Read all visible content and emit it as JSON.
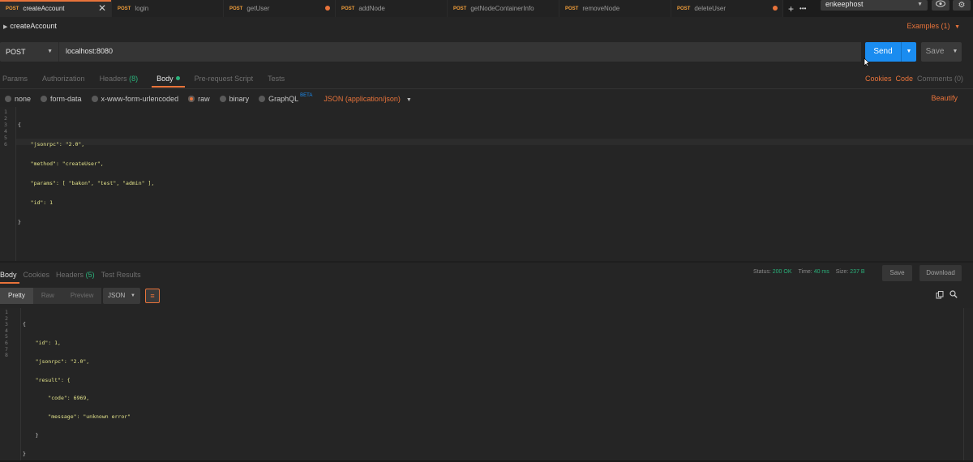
{
  "tabs": [
    {
      "method": "POST",
      "title": "createAccount",
      "active": true,
      "close": "✕"
    },
    {
      "method": "POST",
      "title": "login"
    },
    {
      "method": "POST",
      "title": "getUser",
      "modified": true
    },
    {
      "method": "POST",
      "title": "addNode"
    },
    {
      "method": "POST",
      "title": "getNodeContainerInfo"
    },
    {
      "method": "POST",
      "title": "removeNode"
    },
    {
      "method": "POST",
      "title": "deleteUser",
      "modified": true
    }
  ],
  "tab_actions": {
    "add": "+",
    "more": "•••"
  },
  "environment": {
    "selected": "enkeephost"
  },
  "request": {
    "name": "createAccount",
    "examples": "Examples (1)",
    "method": "POST",
    "url": "localhost:8080",
    "send": "Send",
    "save": "Save"
  },
  "request_tabs": {
    "params": "Params",
    "authorization": "Authorization",
    "headers": "Headers",
    "headers_count": "(8)",
    "body": "Body",
    "prerequest": "Pre-request Script",
    "tests": "Tests"
  },
  "request_links": {
    "cookies": "Cookies",
    "code": "Code",
    "comments": "Comments (0)"
  },
  "body_types": {
    "none": "none",
    "form_data": "form-data",
    "urlencoded": "x-www-form-urlencoded",
    "raw": "raw",
    "binary": "binary",
    "graphql": "GraphQL",
    "beta": "BETA",
    "content_type": "JSON (application/json)",
    "beautify": "Beautify"
  },
  "request_body": {
    "line_numbers": [
      "1",
      "2",
      "3",
      "4",
      "5",
      "6"
    ],
    "lines": [
      "{",
      "    \"jsonrpc\": \"2.0\",",
      "    \"method\": \"createUser\",",
      "    \"params\": [ \"bakon\", \"test\", \"admin\" ],",
      "    \"id\": 1",
      "}"
    ]
  },
  "response_tabs": {
    "body": "Body",
    "cookies": "Cookies",
    "headers": "Headers",
    "headers_count": "(5)",
    "test_results": "Test Results"
  },
  "response_status": {
    "status_label": "Status:",
    "status_value": "200 OK",
    "time_label": "Time:",
    "time_value": "40 ms",
    "size_label": "Size:",
    "size_value": "237 B"
  },
  "response_actions": {
    "save": "Save",
    "download": "Download"
  },
  "response_view": {
    "pretty": "Pretty",
    "raw": "Raw",
    "preview": "Preview",
    "format": "JSON"
  },
  "response_body": {
    "line_numbers": [
      "1",
      "2",
      "3",
      "4",
      "5",
      "6",
      "7",
      "8"
    ],
    "lines": [
      "{",
      "    \"id\": 1,",
      "    \"jsonrpc\": \"2.0\",",
      "    \"result\": {",
      "        \"code\": 6969,",
      "        \"message\": \"unknown error\"",
      "    }",
      "}"
    ]
  },
  "colors": {
    "accent": "#e8733a",
    "send": "#1a8cf0",
    "success": "#2ab27b",
    "background": "#252525"
  }
}
